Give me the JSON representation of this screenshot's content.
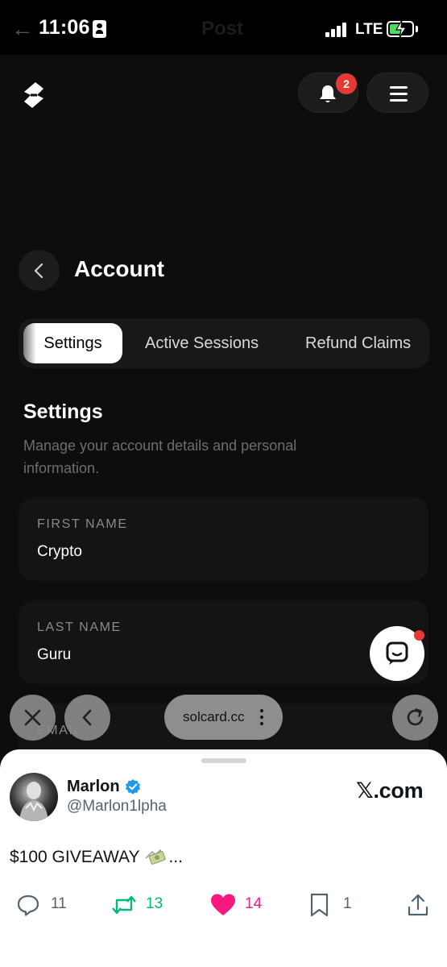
{
  "status_bar": {
    "time": "11:06",
    "network": "LTE",
    "ghost_title": "Post",
    "battery_fill_fraction": 0.55
  },
  "header": {
    "logo_icon": "solcard-logo-icon",
    "notification_count": "2",
    "menu_icon": "hamburger-icon"
  },
  "page": {
    "title": "Account"
  },
  "tabs": [
    {
      "label": "Settings",
      "active": true
    },
    {
      "label": "Active Sessions",
      "active": false
    },
    {
      "label": "Refund Claims",
      "active": false
    }
  ],
  "settings": {
    "title": "Settings",
    "description": "Manage your account details and personal information.",
    "fields": [
      {
        "label": "FIRST NAME",
        "value": "Crypto"
      },
      {
        "label": "LAST NAME",
        "value": "Guru"
      },
      {
        "label": "EMAIL",
        "value": ""
      }
    ]
  },
  "browser": {
    "url": "solcard.cc",
    "close_icon": "close-icon",
    "back_icon": "chevron-left-icon",
    "reload_icon": "reload-icon"
  },
  "tweet": {
    "author_name": "Marlon",
    "handle": "@Marlon1lpha",
    "site": "𝕏.com",
    "text": "$100 GIVEAWAY",
    "text_suffix": "...",
    "replies": "11",
    "reposts": "13",
    "likes": "14",
    "bookmarks": "1"
  },
  "colors": {
    "background": "#0d0d0d",
    "badge": "#e53935",
    "repost": "#00ba7c",
    "like": "#f91880",
    "verified": "#1d9bf0",
    "battery": "#4cd964"
  }
}
